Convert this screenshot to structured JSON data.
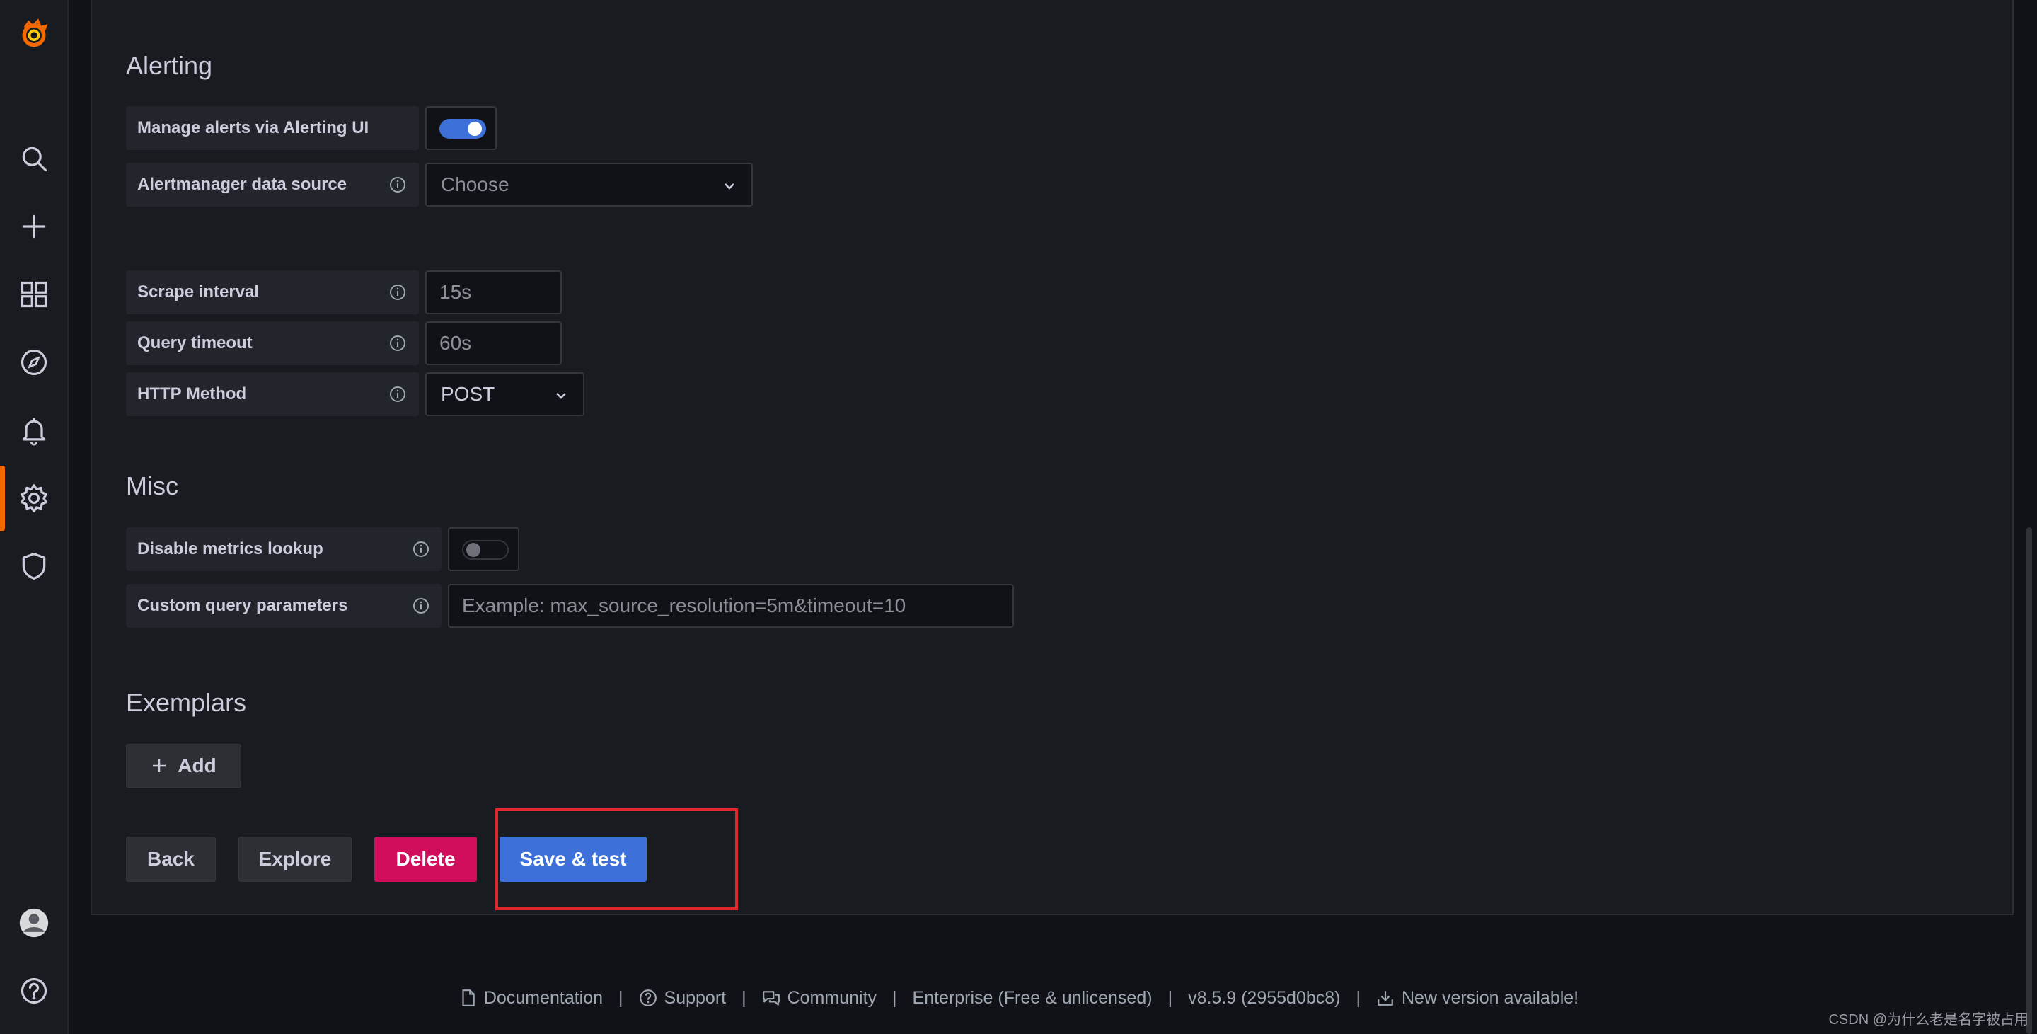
{
  "colors": {
    "accent": "#3d71d9",
    "danger": "#d10e5c",
    "brand": "#f46800",
    "highlight": "#e3262b"
  },
  "nav": {
    "items": [
      "grafana-logo-icon",
      "search-icon",
      "plus-icon",
      "dashboards-icon",
      "explore-icon",
      "alerting-icon",
      "configuration-icon",
      "server-admin-icon",
      "user-avatar-icon",
      "help-icon"
    ],
    "active": "configuration-icon"
  },
  "alerting": {
    "title": "Alerting",
    "manage_alerts_label": "Manage alerts via Alerting UI",
    "manage_alerts_enabled": true,
    "alertmanager_label": "Alertmanager data source",
    "alertmanager_placeholder": "Choose"
  },
  "http": {
    "scrape_label": "Scrape interval",
    "scrape_placeholder": "15s",
    "timeout_label": "Query timeout",
    "timeout_placeholder": "60s",
    "method_label": "HTTP Method",
    "method_value": "POST"
  },
  "misc": {
    "title": "Misc",
    "disable_lookup_label": "Disable metrics lookup",
    "disable_lookup_enabled": false,
    "custom_params_label": "Custom query parameters",
    "custom_params_placeholder": "Example: max_source_resolution=5m&timeout=10"
  },
  "exemplars": {
    "title": "Exemplars",
    "add_label": "Add"
  },
  "actions": {
    "back": "Back",
    "explore": "Explore",
    "delete": "Delete",
    "save": "Save & test"
  },
  "footer": {
    "documentation": "Documentation",
    "support": "Support",
    "community": "Community",
    "edition": "Enterprise (Free & unlicensed)",
    "version": "v8.5.9 (2955d0bc8)",
    "new_version": "New version available!",
    "separator": "|"
  },
  "watermark": "CSDN @为什么老是名字被占用"
}
